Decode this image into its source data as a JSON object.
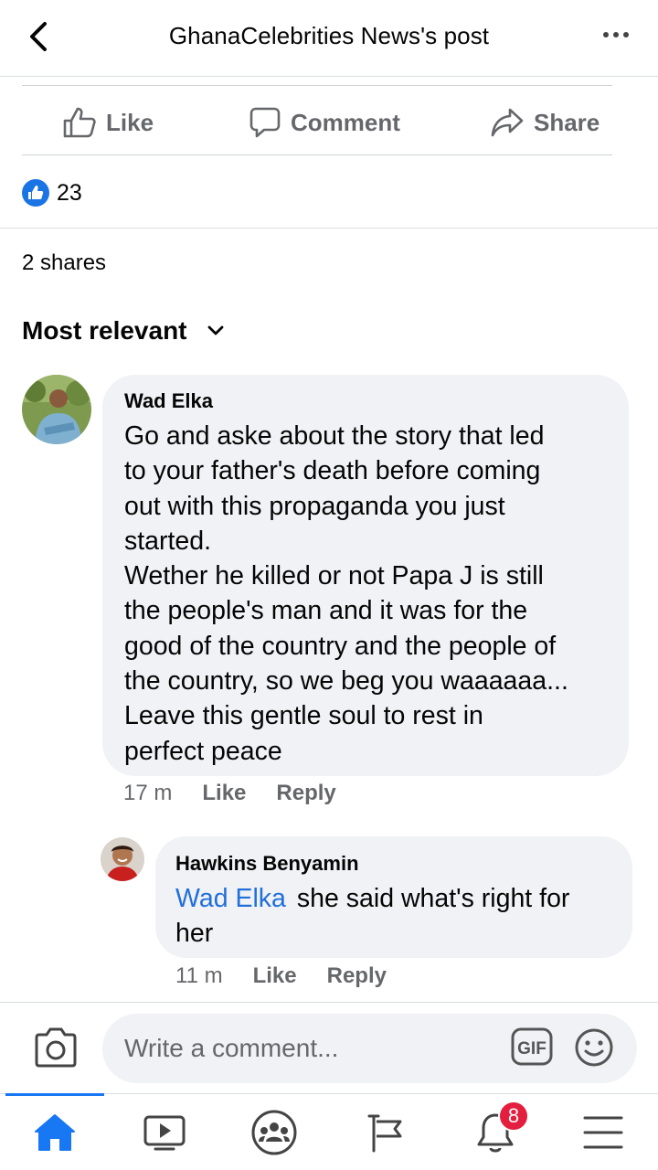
{
  "header": {
    "title": "GhanaCelebrities News's post"
  },
  "actions": {
    "like": "Like",
    "comment": "Comment",
    "share": "Share"
  },
  "reactions": {
    "count": "23"
  },
  "shares": "2 shares",
  "sort": {
    "label": "Most relevant"
  },
  "comments": [
    {
      "author": "Wad Elka",
      "text": "Go and aske about the story that led\nto your father's death before coming\nout with this propaganda you just\nstarted.\nWether he killed or not Papa J is still\nthe people's man and it was for the\ngood of the country and the people of\nthe country, so we beg you waaaaaa...\nLeave this gentle soul to rest in\nperfect peace",
      "time": "17 m",
      "like": "Like",
      "reply": "Reply"
    },
    {
      "author": "Hawkins Benyamin",
      "mention": "Wad Elka",
      "text": "she said what's right for\nher",
      "time": "11 m",
      "like": "Like",
      "reply": "Reply"
    }
  ],
  "composer": {
    "placeholder": "Write a comment...",
    "gif": "GIF"
  },
  "tabbar": {
    "notifications_badge": "8"
  },
  "icons": [
    "back-icon",
    "more-icon",
    "like-icon",
    "comment-icon",
    "share-icon",
    "camera-icon",
    "gif-icon",
    "emoji-icon",
    "home-icon",
    "video-icon",
    "groups-icon",
    "pages-icon",
    "bell-icon",
    "menu-icon"
  ],
  "colors": {
    "accent": "#1877f2",
    "mention": "#216fdb",
    "badge": "#e41e3f",
    "bubble": "#f0f2f5",
    "secondary_text": "#65676b"
  }
}
